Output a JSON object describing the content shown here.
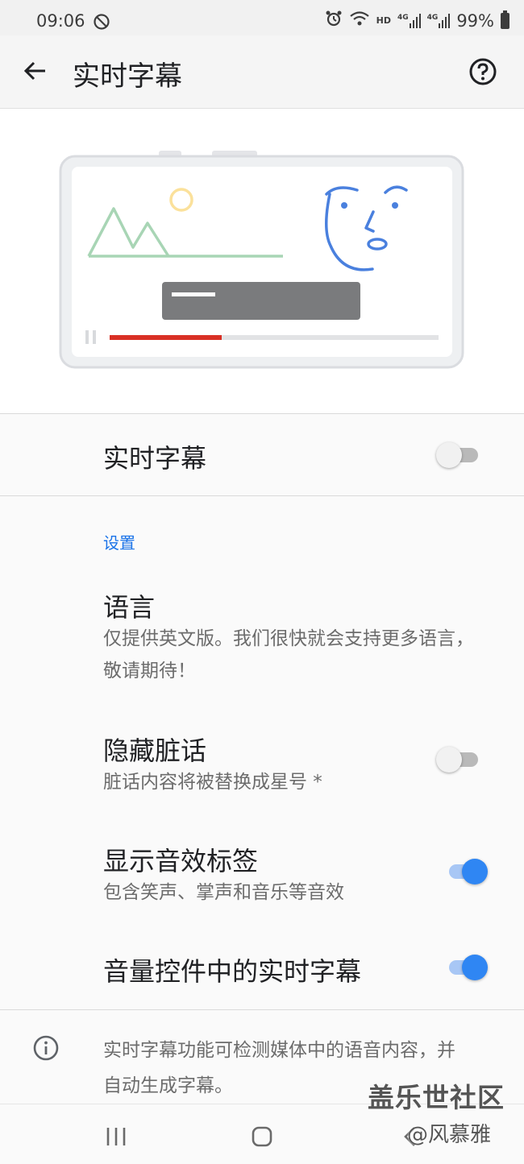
{
  "status_bar": {
    "time": "09:06",
    "network_label": "HD",
    "signal_label_1": "4G",
    "signal_label_2": "4G",
    "battery": "99%"
  },
  "app_bar": {
    "title": "实时字幕",
    "back_icon": "arrow-back-icon",
    "help_icon": "help-circle-icon"
  },
  "master_switch": {
    "label": "实时字幕",
    "enabled": false
  },
  "settings_section": {
    "header": "设置",
    "items": [
      {
        "title": "语言",
        "summary": "仅提供英文版。我们很快就会支持更多语言，敬请期待！"
      },
      {
        "title": "隐藏脏话",
        "summary": "脏话内容将被替换成星号 *",
        "enabled": false
      },
      {
        "title": "显示音效标签",
        "summary": "包含笑声、掌声和音乐等音效",
        "enabled": true
      },
      {
        "title": "音量控件中的实时字幕",
        "enabled": true
      }
    ]
  },
  "footer": {
    "info_text": "实时字幕功能可检测媒体中的语音内容，并自动生成字幕。"
  },
  "watermark": {
    "main": "盖乐世社区",
    "sub": "@风慕雅"
  },
  "colors": {
    "accent": "#1a73e8",
    "toggle_on": "#2f86f3",
    "progress_red": "#d93025"
  }
}
